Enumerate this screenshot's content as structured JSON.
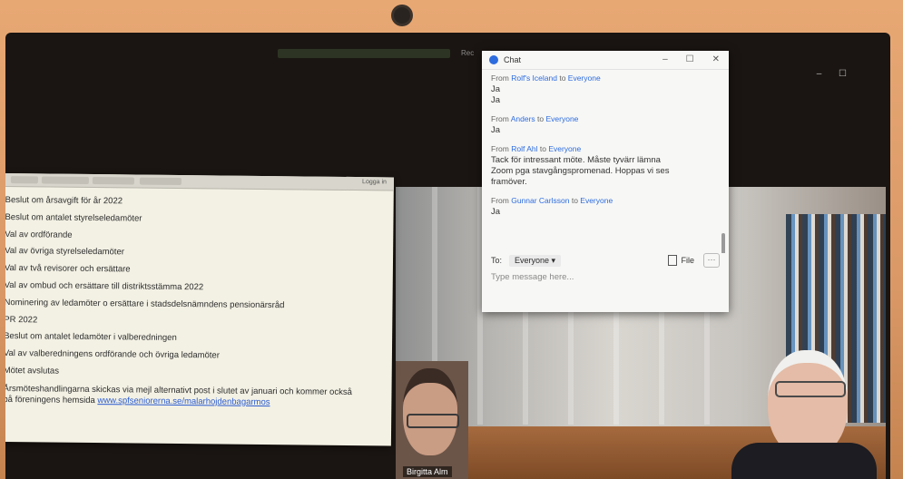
{
  "participants": {
    "bottom_left_name": "Birgitta Alm"
  },
  "zoom_header": {
    "right_text": "Rec"
  },
  "document": {
    "toolbar_right": "Logga in",
    "lines": [
      "Beslut om årsavgift för år 2022",
      "Beslut om antalet styrelseledamöter",
      "Val av ordförande",
      "Val av övriga styrelseledamöter",
      "Val av två revisorer och ersättare",
      "Val av ombud och ersättare till distriktsstämma 2022",
      "Nominering av ledamöter o ersättare i stadsdelsnämndens pensionärsråd",
      "PR 2022",
      "Beslut om antalet ledamöter i valberedningen",
      "Val av valberedningens ordförande och övriga ledamöter",
      "Mötet avslutas"
    ],
    "closing_line_1": "Årsmöteshandlingarna skickas via mejl alternativt post i slutet av januari och kommer också",
    "closing_line_2_prefix": "på föreningens hemsida ",
    "closing_link": "www.spfseniorerna.se/malarhojdenbagarmos"
  },
  "chat": {
    "title": "Chat",
    "controls": [
      "–",
      "☐",
      "✕"
    ],
    "messages": [
      {
        "from_prefix": "From ",
        "from": "Rolf's Iceland",
        "to_prefix": " to ",
        "to": "Everyone",
        "text_lines": [
          "Ja",
          "Ja"
        ]
      },
      {
        "from_prefix": "From ",
        "from": "Anders",
        "to_prefix": " to ",
        "to": "Everyone",
        "text_lines": [
          "Ja"
        ]
      },
      {
        "from_prefix": "From ",
        "from": "Rolf Ahl",
        "to_prefix": " to ",
        "to": "Everyone",
        "text_lines": [
          "Tack för intressant möte. Måste tyvärr lämna",
          "Zoom pga stavgångspromenad. Hoppas vi ses",
          "framöver."
        ]
      },
      {
        "from_prefix": "From ",
        "from": "Gunnar Carlsson",
        "to_prefix": " to ",
        "to": "Everyone",
        "text_lines": [
          "Ja"
        ]
      }
    ],
    "to_label": "To:",
    "to_value": "Everyone ▾",
    "file_label": "File",
    "more_label": "···",
    "input_placeholder": "Type message here..."
  },
  "colors": {
    "zoom_blue": "#2d6cdf",
    "bezel_orange": "#d99866"
  }
}
